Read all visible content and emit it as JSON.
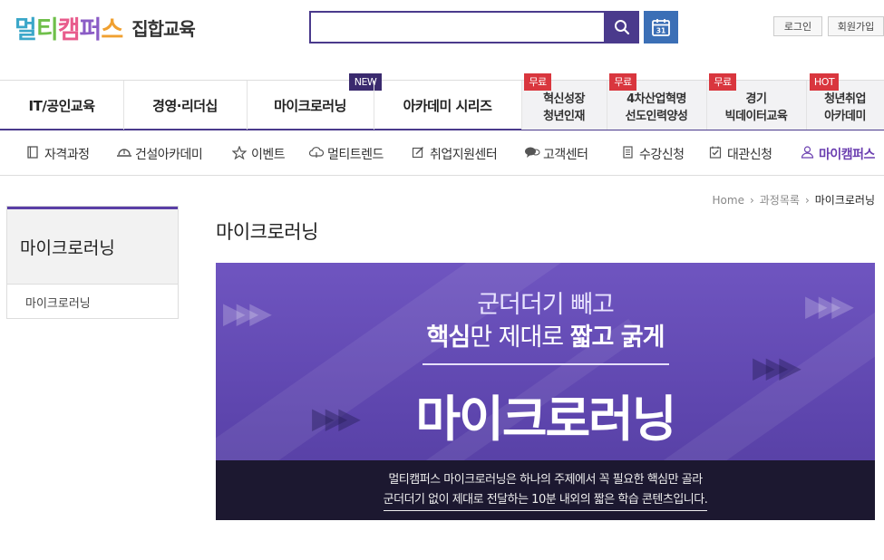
{
  "header": {
    "logo_brand": [
      "멀",
      "티",
      "캠",
      "퍼",
      "스"
    ],
    "logo_sub": "집합교육",
    "search_placeholder": "",
    "login": "로그인",
    "join": "회원가입",
    "calendar_day": "31"
  },
  "gnb": {
    "items": [
      {
        "label": "IT/공인교육"
      },
      {
        "label": "경영·리더십"
      },
      {
        "label": "마이크로러닝",
        "badge": "NEW"
      },
      {
        "label": "아카데미 시리즈"
      }
    ],
    "special": [
      {
        "line1": "혁신성장",
        "line2": "청년인재",
        "badge": "무료"
      },
      {
        "line1": "4차산업혁명",
        "line2": "선도인력양성",
        "badge": "무료"
      },
      {
        "line1": "경기",
        "line2": "빅데이터교육",
        "badge": "무료"
      },
      {
        "line1": "청년취업",
        "line2": "아카데미",
        "badge": "HOT"
      }
    ]
  },
  "snb": {
    "items": [
      {
        "label": "자격과정",
        "icon": "book-icon"
      },
      {
        "label": "건설아카데미",
        "icon": "helmet-icon"
      },
      {
        "label": "이벤트",
        "icon": "star-icon"
      },
      {
        "label": "멀티트렌드",
        "icon": "cloud-icon"
      },
      {
        "label": "취업지원센터",
        "icon": "pencil-icon"
      },
      {
        "label": "고객센터",
        "icon": "chat-icon"
      },
      {
        "label": "수강신청",
        "icon": "document-icon"
      },
      {
        "label": "대관신청",
        "icon": "checkbox-icon"
      },
      {
        "label": "마이캠퍼스",
        "icon": "person-icon"
      }
    ]
  },
  "breadcrumb": {
    "home": "Home",
    "list": "과정목록",
    "current": "마이크로러닝"
  },
  "lnb": {
    "title": "마이크로러닝",
    "items": [
      "마이크로러닝"
    ]
  },
  "page_title": "마이크로러닝",
  "banner": {
    "line1": "군더더기 빼고",
    "line2_bold1": "핵심",
    "line2_mid": "만 제대로 ",
    "line2_bold2": "짧고 굵게",
    "big": "마이크로러닝",
    "foot1": "멀티캠퍼스 마이크로러닝은 하나의 주제에서 꼭 필요한 핵심만 골라",
    "foot2": "군더더기 없이 제대로 전달하는 10분 내외의 짧은 학습 콘텐츠입니다."
  },
  "colors": {
    "accent": "#4a3a8c",
    "calendar": "#3b6fb6",
    "badge_red": "#d9363e",
    "active_menu": "#6b3fb0"
  }
}
